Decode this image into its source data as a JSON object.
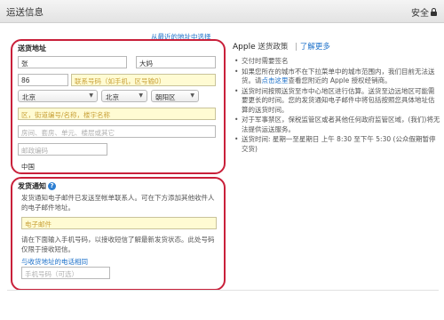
{
  "header": {
    "title": "运送信息",
    "secure_label": "安全"
  },
  "address_section": {
    "recent_link": "从最近的地址中选择",
    "title": "送货地址",
    "last_name": "张",
    "first_name": "大妈",
    "phone_prefix": "86",
    "phone_placeholder": "联系号码（如手机，区号输0）",
    "province": "北京",
    "city": "北京",
    "district": "朝阳区",
    "street_placeholder": "区，街道编号/名称，楼宇名称",
    "apartment_placeholder": "房间、套房、单元、楼层或其它",
    "postcode_placeholder": "邮政编码",
    "country": "中国"
  },
  "notify_section": {
    "title": "发货通知",
    "help_icon": "?",
    "email_desc": "发货通知电子邮件已发送至帐单联系人。可在下方添加其他收件人的电子邮件地址。",
    "email_placeholder": "电子邮件",
    "sms_desc": "请在下面输入手机号码，以接收短信了解最新发货状态。此处号码仅限于接收短信。",
    "same_phone_link": "与收货地址的电话相同",
    "mobile_placeholder": "手机号码（可选）"
  },
  "policy": {
    "apple": "Apple",
    "title": "送货政策",
    "learn_more": "了解更多",
    "bullets": [
      "交付时需要签名",
      "如果您所在的城市不在下拉菜单中的城市范围内，我们目前无法送货。请点击这里查看您附近的 Apple 授权经销商。",
      "送货时间按照送货至市中心地区进行估算。送货至边远地区可能需要更长的时间。您的发货通知电子邮件中将包括按照您具体地址估算的送货时间。",
      "对于军事禁区，保税监管区或者其他任何政府监管区域，(我们)将无法提供运送服务。",
      "送货时间: 星期一至星期日 上午 8:30 至下午 5:30 (公众假期暂停交货)"
    ],
    "link_text": "点击这里"
  }
}
